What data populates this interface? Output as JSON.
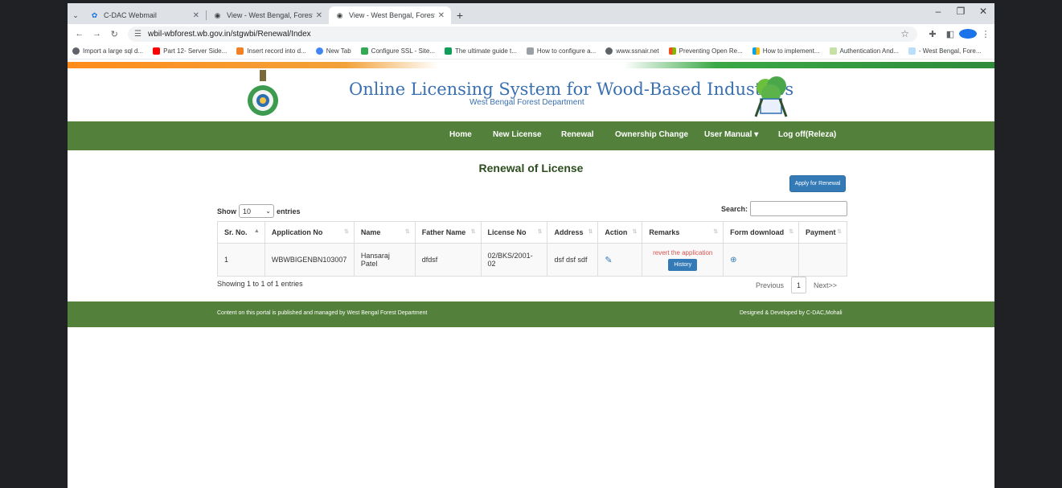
{
  "browser": {
    "tabs": [
      {
        "title": "C-DAC Webmail",
        "active": false
      },
      {
        "title": "View - West Bengal, Forest Dep",
        "active": false
      },
      {
        "title": "View - West Bengal, Forest Dep",
        "active": true
      }
    ],
    "url": "wbil-wbforest.wb.gov.in/stgwbi/Renewal/Index",
    "bookmarks": [
      "Import a large sql d...",
      "Part 12- Server Side...",
      "Insert record into d...",
      "New Tab",
      "Configure SSL - Site...",
      "The ultimate guide t...",
      "How to configure a...",
      "www.ssnair.net",
      "Preventing Open Re...",
      "How to implement...",
      "Authentication And...",
      "- West Bengal, Fore..."
    ]
  },
  "site": {
    "title": "Online Licensing System for Wood-Based Industries",
    "subtitle": "West Bengal Forest Department",
    "nav": [
      "Home",
      "New License",
      "Renewal",
      "Ownership Change",
      "User Manual ▾",
      "Log off(Releza)"
    ]
  },
  "page": {
    "heading": "Renewal of License",
    "apply_button": "Apply for Renewal",
    "show_label": "Show",
    "entries_label": "entries",
    "length_value": "10",
    "search_label": "Search:",
    "columns": [
      "Sr. No.",
      "Application No",
      "Name",
      "Father Name",
      "License No",
      "Address",
      "Action",
      "Remarks",
      "Form download",
      "Payment"
    ],
    "row": {
      "sr_no": "1",
      "application_no": "WBWBIGENBN103007",
      "name": "Hansaraj Patel",
      "father_name": "dfdsf",
      "license_no": "02/BKS/2001-02",
      "address": "dsf dsf sdf",
      "remark": "revert the application",
      "history_button": "History"
    },
    "info": "Showing 1 to 1 of 1 entries",
    "pagination": {
      "previous": "Previous",
      "current": "1",
      "next": "Next>>"
    }
  },
  "footer": {
    "left": "Content on this portal is published and managed by West Bengal Forest Department",
    "right": "Designed & Developed by C-DAC,Mohali"
  },
  "colors": {
    "nav_green": "#53803b",
    "title_blue": "#3a6fb0",
    "button_blue": "#337ab7",
    "remark_red": "#d9534f"
  }
}
